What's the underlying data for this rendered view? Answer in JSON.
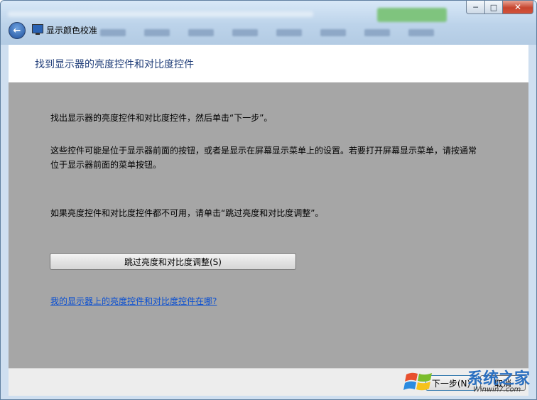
{
  "window": {
    "title": "显示颜色校准",
    "caption_buttons": {
      "minimize": "─",
      "maximize": "□",
      "close": "✕"
    },
    "back_icon": "arrow-left"
  },
  "page": {
    "header": "找到显示器的亮度控件和对比度控件",
    "para1": "找出显示器的亮度控件和对比度控件，然后单击“下一步”。",
    "para2": "这些控件可能是位于显示器前面的按钮，或者是显示在屏幕显示菜单上的设置。若要打开屏幕显示菜单，请按通常位于显示器前面的菜单按钮。",
    "para3": "如果亮度控件和对比度控件都不可用，请单击“跳过亮度和对比度调整”。",
    "skip_button": "跳过亮度和对比度调整(S)",
    "help_link": "我的显示器上的亮度控件和对比度控件在哪?"
  },
  "footer": {
    "next_button": "下一步(N)",
    "cancel_button": "取消"
  },
  "watermark": {
    "text": "系统之家",
    "url": "Winwin7.com"
  },
  "colors": {
    "content_bg": "#a6a6a6",
    "header_text": "#1e3c78",
    "link": "#0a4fd1"
  }
}
